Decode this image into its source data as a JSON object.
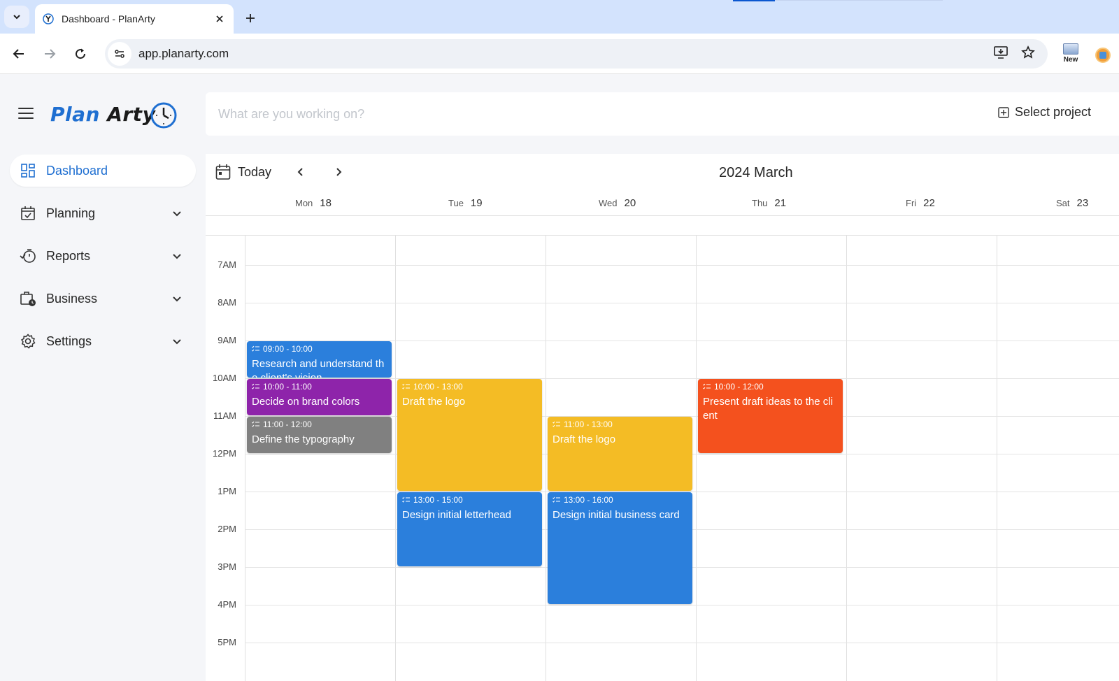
{
  "browser": {
    "tab_title": "Dashboard - PlanArty",
    "url": "app.planarty.com",
    "ext_new_label": "New"
  },
  "app": {
    "logo_plan": "Plan",
    "logo_arty": "Arty",
    "nav": [
      {
        "label": "Dashboard",
        "icon": "dashboard-grid-icon",
        "active": true
      },
      {
        "label": "Planning",
        "icon": "calendar-check-icon"
      },
      {
        "label": "Reports",
        "icon": "timer-check-icon"
      },
      {
        "label": "Business",
        "icon": "briefcase-clock-icon"
      },
      {
        "label": "Settings",
        "icon": "gear-icon"
      }
    ],
    "work_placeholder": "What are you working on?",
    "select_project": "Select project"
  },
  "calendar": {
    "today_label": "Today",
    "month_title": "2024 March",
    "days": [
      {
        "name": "Mon",
        "num": "18"
      },
      {
        "name": "Tue",
        "num": "19"
      },
      {
        "name": "Wed",
        "num": "20"
      },
      {
        "name": "Thu",
        "num": "21"
      },
      {
        "name": "Fri",
        "num": "22"
      },
      {
        "name": "Sat",
        "num": "23"
      }
    ],
    "hours": [
      "7AM",
      "8AM",
      "9AM",
      "10AM",
      "11AM",
      "12PM",
      "1PM",
      "2PM",
      "3PM",
      "4PM",
      "5PM"
    ],
    "events": [
      {
        "day": 0,
        "start": 9,
        "end": 10,
        "time": "09:00 - 10:00",
        "title": "Research and understand the client's vision",
        "color": "#2b7fdc"
      },
      {
        "day": 0,
        "start": 10,
        "end": 11,
        "time": "10:00 - 11:00",
        "title": "Decide on brand colors",
        "color": "#8e24aa"
      },
      {
        "day": 0,
        "start": 11,
        "end": 12,
        "time": "11:00 - 12:00",
        "title": "Define the typography",
        "color": "#808080"
      },
      {
        "day": 1,
        "start": 10,
        "end": 13,
        "time": "10:00 - 13:00",
        "title": "Draft the logo",
        "color": "#f4bc25"
      },
      {
        "day": 1,
        "start": 13,
        "end": 15,
        "time": "13:00 - 15:00",
        "title": "Design initial letterhead",
        "color": "#2b7fdc"
      },
      {
        "day": 2,
        "start": 11,
        "end": 13,
        "time": "11:00 - 13:00",
        "title": "Draft the logo",
        "color": "#f4bc25"
      },
      {
        "day": 2,
        "start": 13,
        "end": 16,
        "time": "13:00 - 16:00",
        "title": "Design initial business card",
        "color": "#2b7fdc"
      },
      {
        "day": 3,
        "start": 10,
        "end": 12,
        "time": "10:00 - 12:00",
        "title": "Present draft ideas to the client",
        "color": "#f4511e"
      }
    ]
  }
}
